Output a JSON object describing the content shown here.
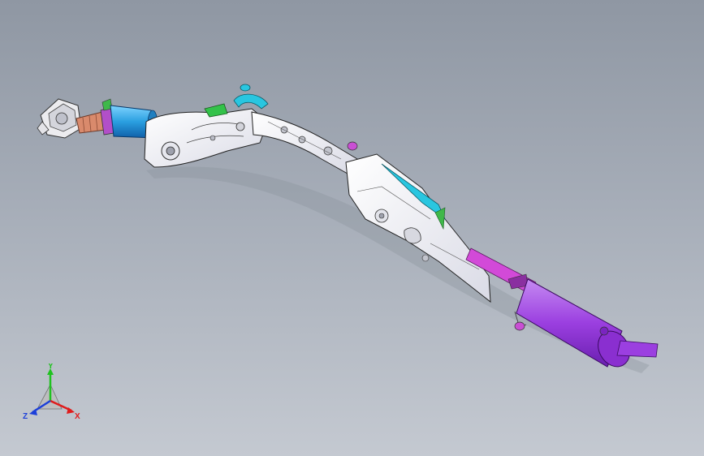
{
  "viewport": {
    "background_top": "#8f97a3",
    "background_bottom": "#c4c9d1"
  },
  "model": {
    "parts": [
      {
        "name": "flange-connector",
        "color": "#e8e8ea"
      },
      {
        "name": "flex-pipe",
        "color": "#d98a6c"
      },
      {
        "name": "catalytic-converter",
        "color": "#2a9fe0"
      },
      {
        "name": "heat-shield-front",
        "color": "#f4f4f8"
      },
      {
        "name": "heat-shield-rear",
        "color": "#f4f4f8"
      },
      {
        "name": "bracket-green",
        "color": "#33c24a"
      },
      {
        "name": "bracket-cyan",
        "color": "#29c6e0"
      },
      {
        "name": "tail-pipe-link",
        "color": "#d24ad8"
      },
      {
        "name": "rear-muffler",
        "color": "#9b3fe0"
      }
    ]
  },
  "triad": {
    "x_label": "X",
    "y_label": "Y",
    "z_label": "Z",
    "x_color": "#e01c1c",
    "y_color": "#1fc21f",
    "z_color": "#1c3fd9"
  }
}
